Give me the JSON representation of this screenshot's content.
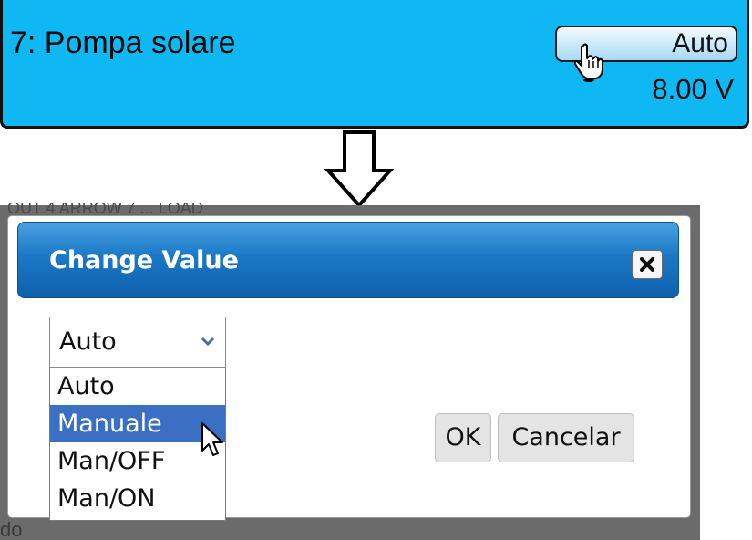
{
  "panel": {
    "title": "7: Pompa solare",
    "mode_label": "Auto",
    "voltage": "8.00 V"
  },
  "background": {
    "ghost_top": "OUT 4 ARROW 7 ... LOAD",
    "ghost_bottom": "do"
  },
  "dialog": {
    "title": "Change Value",
    "select": {
      "value": "Auto",
      "options": [
        {
          "label": "Auto",
          "selected": false
        },
        {
          "label": "Manuale",
          "selected": true
        },
        {
          "label": "Man/OFF",
          "selected": false
        },
        {
          "label": "Man/ON",
          "selected": false
        }
      ]
    },
    "ok_label": "OK",
    "cancel_label": "Cancelar"
  },
  "colors": {
    "panel_bg": "#0fb8f3",
    "header_blue": "#1b78c7",
    "selected_option": "#3b6fc3",
    "backdrop": "#6b6b6b"
  },
  "icons": [
    "hand-pointer-cursor-icon",
    "down-arrow-icon",
    "close-icon",
    "chevron-down-icon",
    "arrow-pointer-cursor-icon"
  ]
}
